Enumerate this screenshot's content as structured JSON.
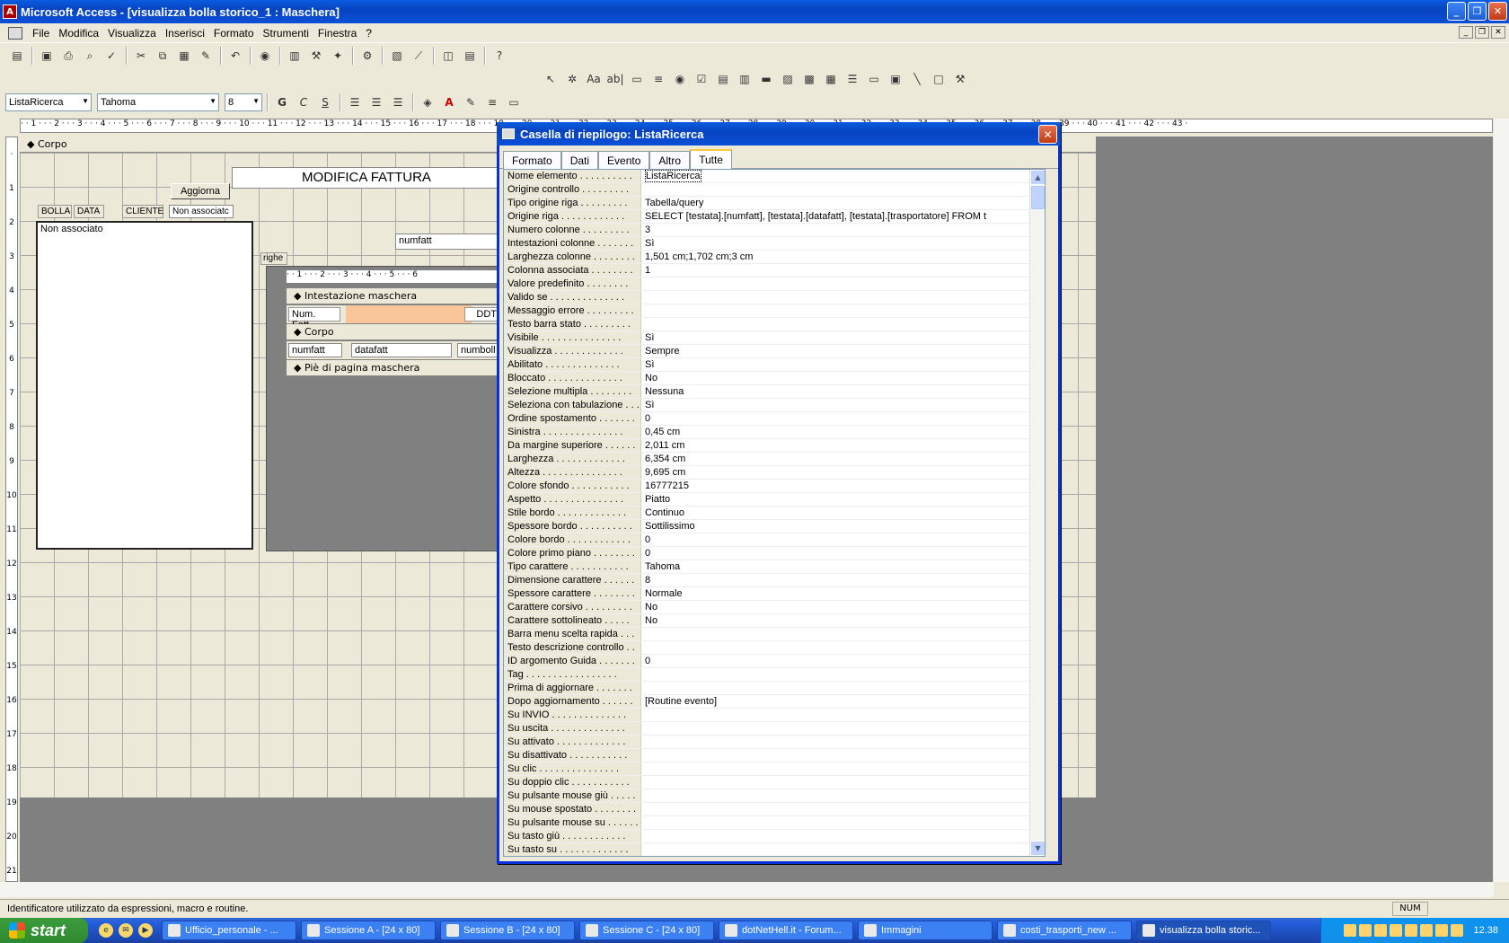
{
  "window": {
    "title": "Microsoft Access - [visualizza bolla storico_1 : Maschera]",
    "min": "_",
    "max": "❐",
    "close": "✕"
  },
  "menu": {
    "items": [
      "File",
      "Modifica",
      "Visualizza",
      "Inserisci",
      "Formato",
      "Strumenti",
      "Finestra",
      "?"
    ]
  },
  "formatbar": {
    "object": "ListaRicerca",
    "font": "Tahoma",
    "size": "8",
    "bold": "G",
    "italic": "C",
    "underline": "S"
  },
  "ruler": {
    "h": "· · 1 · · · 2 · · · 3 · · · 4 · · · 5 · · · 6 · · · 7 · · · 8 · · · 9 · · · 10 · · · 11 · · · 12 · · · 13 · · · 14 · · · 15 · · · 16 · · · 17 · · · 18 · · · 19 · · · 20 · · · 21 · · · 22 · · · 23 · · · 24 · · · 25 · · · 26 · · · 27 · · · 28 · · · 29 · · · 30 · · · 31 · · · 32 · · · 33 · · · 34 · · · 35 · · · 36 · · · 37 · · · 38 · · · 39 · · · 40 · · · 41 · · · 42 · · · 43 ·",
    "v": [
      "·",
      "1",
      "2",
      "3",
      "4",
      "5",
      "6",
      "7",
      "8",
      "9",
      "10",
      "11",
      "12",
      "13",
      "14",
      "15",
      "16",
      "17",
      "18",
      "19",
      "20",
      "21"
    ]
  },
  "form": {
    "section": "Corpo",
    "title": "MODIFICA FATTURA",
    "button_refresh": "Aggiorna",
    "col_bolla": "BOLLA",
    "col_data": "DATA",
    "col_cliente": "CLIENTE",
    "unbound_top": "Non associatc",
    "listbox_text": "Non associato",
    "numfatt": "numfatt",
    "righe": "righe"
  },
  "subform": {
    "ruler": "· · 1 · · · 2 · · · 3 · · · 4 · · · 5 · · · 6",
    "header": "Intestazione maschera",
    "num_fatt": "Num. Fatt.",
    "ddt": "DDT",
    "body": "Corpo",
    "f_numfatt": "numfatt",
    "f_datafatt": "datafatt",
    "f_numboll": "numboll",
    "footer": "Piè di pagina maschera"
  },
  "dialog": {
    "title": "Casella di riepilogo: ListaRicerca",
    "tabs": [
      "Formato",
      "Dati",
      "Evento",
      "Altro",
      "Tutte"
    ],
    "properties": [
      {
        "name": "Nome elemento . . . . . . . . . .",
        "value": "ListaRicerca"
      },
      {
        "name": "Origine controllo . . . . . . . . .",
        "value": ""
      },
      {
        "name": "Tipo origine riga . . . . . . . . .",
        "value": "Tabella/query"
      },
      {
        "name": "Origine riga . . . . . . . . . . . .",
        "value": "SELECT [testata].[numfatt], [testata].[datafatt], [testata].[trasportatore] FROM t"
      },
      {
        "name": "Numero colonne . . . . . . . . .",
        "value": "3"
      },
      {
        "name": "Intestazioni colonne . . . . . . .",
        "value": "Sì"
      },
      {
        "name": "Larghezza colonne . . . . . . . .",
        "value": "1,501 cm;1,702 cm;3 cm"
      },
      {
        "name": "Colonna associata . . . . . . . .",
        "value": "1"
      },
      {
        "name": "Valore predefinito . . . . . . . .",
        "value": ""
      },
      {
        "name": "Valido se . . . . . . . . . . . . . .",
        "value": ""
      },
      {
        "name": "Messaggio errore . . . . . . . . .",
        "value": ""
      },
      {
        "name": "Testo barra stato . . . . . . . . .",
        "value": ""
      },
      {
        "name": "Visibile . . . . . . . . . . . . . . .",
        "value": "Sì"
      },
      {
        "name": "Visualizza . . . . . . . . . . . . .",
        "value": "Sempre"
      },
      {
        "name": "Abilitato . . . . . . . . . . . . . .",
        "value": "Sì"
      },
      {
        "name": "Bloccato . . . . . . . . . . . . . .",
        "value": "No"
      },
      {
        "name": "Selezione multipla . . . . . . . .",
        "value": "Nessuna"
      },
      {
        "name": "Seleziona con tabulazione . . .",
        "value": "Sì"
      },
      {
        "name": "Ordine spostamento . . . . . . .",
        "value": "0"
      },
      {
        "name": "Sinistra . . . . . . . . . . . . . . .",
        "value": "0,45 cm"
      },
      {
        "name": "Da margine superiore . . . . . .",
        "value": "2,011 cm"
      },
      {
        "name": "Larghezza . . . . . . . . . . . . .",
        "value": "6,354 cm"
      },
      {
        "name": "Altezza . . . . . . . . . . . . . . .",
        "value": "9,695 cm"
      },
      {
        "name": "Colore sfondo . . . . . . . . . . .",
        "value": "16777215"
      },
      {
        "name": "Aspetto . . . . . . . . . . . . . . .",
        "value": "Piatto"
      },
      {
        "name": "Stile bordo . . . . . . . . . . . . .",
        "value": "Continuo"
      },
      {
        "name": "Spessore bordo . . . . . . . . . .",
        "value": "Sottilissimo"
      },
      {
        "name": "Colore bordo . . . . . . . . . . . .",
        "value": "0"
      },
      {
        "name": "Colore primo piano . . . . . . . .",
        "value": "0"
      },
      {
        "name": "Tipo carattere . . . . . . . . . . .",
        "value": "Tahoma"
      },
      {
        "name": "Dimensione carattere . . . . . .",
        "value": "8"
      },
      {
        "name": "Spessore carattere . . . . . . . .",
        "value": "Normale"
      },
      {
        "name": "Carattere corsivo . . . . . . . . .",
        "value": "No"
      },
      {
        "name": "Carattere sottolineato . . . . .",
        "value": "No"
      },
      {
        "name": "Barra menu scelta rapida . . .",
        "value": ""
      },
      {
        "name": "Testo descrizione controllo . .",
        "value": ""
      },
      {
        "name": "ID argomento Guida . . . . . . .",
        "value": "0"
      },
      {
        "name": "Tag . . . . . . . . . . . . . . . . .",
        "value": ""
      },
      {
        "name": "Prima di aggiornare . . . . . . .",
        "value": ""
      },
      {
        "name": "Dopo aggiornamento . . . . . .",
        "value": "[Routine evento]"
      },
      {
        "name": "Su INVIO . . . . . . . . . . . . . .",
        "value": ""
      },
      {
        "name": "Su uscita . . . . . . . . . . . . . .",
        "value": ""
      },
      {
        "name": "Su attivato . . . . . . . . . . . . .",
        "value": ""
      },
      {
        "name": "Su disattivato . . . . . . . . . . .",
        "value": ""
      },
      {
        "name": "Su clic . . . . . . . . . . . . . . .",
        "value": ""
      },
      {
        "name": "Su doppio clic . . . . . . . . . . .",
        "value": ""
      },
      {
        "name": "Su pulsante mouse giù . . . . .",
        "value": ""
      },
      {
        "name": "Su mouse spostato . . . . . . . .",
        "value": ""
      },
      {
        "name": "Su pulsante mouse su . . . . . .",
        "value": ""
      },
      {
        "name": "Su tasto giù . . . . . . . . . . . .",
        "value": ""
      },
      {
        "name": "Su tasto su . . . . . . . . . . . . .",
        "value": ""
      }
    ]
  },
  "status": {
    "message": "Identificatore utilizzato da espressioni, macro e routine.",
    "num": "NUM"
  },
  "taskbar": {
    "start": "start",
    "tasks": [
      "Ufficio_personale - ...",
      "Sessione A - [24 x 80]",
      "Sessione B - [24 x 80]",
      "Sessione C - [24 x 80]",
      "dotNetHell.it - Forum...",
      "Immagini",
      "costi_trasporti_new ...",
      "visualizza bolla storic..."
    ],
    "clock": "12.38"
  }
}
